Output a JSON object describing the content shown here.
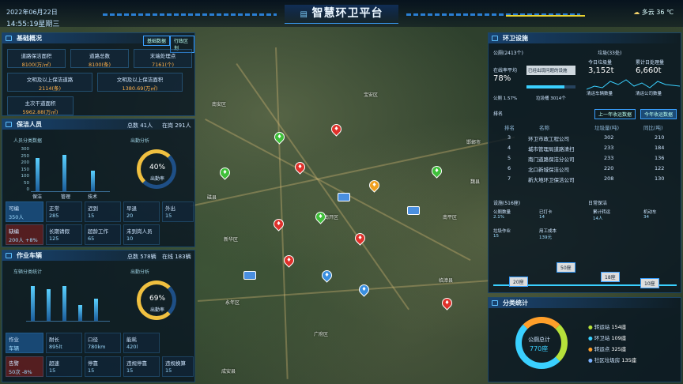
{
  "header": {
    "title": "智慧环卫平台",
    "date": "2022年06月22日",
    "time": "14:55:19星期三",
    "weather": "多云",
    "temp": "36 ℃"
  },
  "basic": {
    "title": "基础概况",
    "tab1": "基础数据",
    "tab2": "行政区划",
    "cells": [
      {
        "l": "道路保洁面积",
        "v": "8100(万/㎡)"
      },
      {
        "l": "道路总数",
        "v": "8100(条)"
      },
      {
        "l": "末端处理点",
        "v": "7161(个)"
      },
      {
        "l": "文明及以上保洁道路",
        "v": "2114(条)"
      },
      {
        "l": "文明及以上保洁面积",
        "v": "1380.69(万㎡)"
      },
      {
        "l": "主次干道面积",
        "v": "5962.88(万㎡)"
      }
    ]
  },
  "staff": {
    "title": "保洁人员",
    "total": "总数  41人",
    "online": "在岗 291人",
    "l1": "人员分类数据",
    "l2": "出勤分析",
    "yaxis": [
      "300",
      "250",
      "200",
      "150",
      "100",
      "50",
      "0"
    ],
    "cats": [
      "保洁",
      "管理",
      "技术"
    ],
    "rate": "40%",
    "rate_label": "出勤率",
    "grid": [
      {
        "l": "可编",
        "v": "350人"
      },
      {
        "l": "正常",
        "v": "285"
      },
      {
        "l": "迟到",
        "v": "15"
      },
      {
        "l": "早退",
        "v": "20"
      },
      {
        "l": "外出",
        "v": "15"
      },
      {
        "l": "缺编",
        "v": "200人 +8%"
      },
      {
        "l": "长期请假",
        "v": "125"
      },
      {
        "l": "超龄工作",
        "v": "65"
      },
      {
        "l": "未到岗人员",
        "v": "10"
      }
    ]
  },
  "vehicle": {
    "title": "作业车辆",
    "total": "总数  578辆",
    "online": "在线 183辆",
    "l1": "车辆分类统计",
    "l2": "出勤分析",
    "rate": "69%",
    "rate_label": "出勤率",
    "grid": [
      {
        "l": "作业",
        "v": "车辆"
      },
      {
        "l": "耐长",
        "v": "895lt"
      },
      {
        "l": "口径",
        "v": "780km"
      },
      {
        "l": "能耗",
        "v": "420l"
      },
      {
        "l": "告警",
        "v": "50次 -8%"
      },
      {
        "l": "超速",
        "v": "15"
      },
      {
        "l": "停靠",
        "v": "15"
      },
      {
        "l": "违规停靠",
        "v": "15"
      },
      {
        "l": "违规换算",
        "v": "15"
      }
    ]
  },
  "facility": {
    "title": "环卫设施",
    "toilet": "公厕(2413个)",
    "rate_label": "在线率平均",
    "rate": "78%",
    "btn": "已经出现问题的设施",
    "rate2": "公厕 1.57%",
    "rate3": "垃圾桶 3014个",
    "trash": "垃圾(33处)",
    "today": "今日垃圾量",
    "today_v": "3,152t",
    "total": "累计日处理量",
    "total_v": "6,660t",
    "t1": "清运车辆数量",
    "t2": "清运公司数量",
    "rank_title": "排名",
    "tab_a": "上一年收运数据",
    "tab_b": "今年收运数据",
    "rank": {
      "cols": [
        "排名",
        "名称",
        "垃圾量(吨)",
        "同比(吨)"
      ],
      "rows": [
        [
          "3",
          "环卫市政工程公司",
          "302",
          "210"
        ],
        [
          "4",
          "城市管理局道路清扫",
          "233",
          "184"
        ],
        [
          "5",
          "南门道路保洁分公司",
          "233",
          "136"
        ],
        [
          "6",
          "北口新城保洁公司",
          "220",
          "122"
        ],
        [
          "7",
          "新大地环卫保洁公司",
          "208",
          "130"
        ]
      ]
    },
    "stat1": "设施(516座)",
    "stat2": "日常保洁",
    "sub": [
      {
        "l": "公厕数量",
        "v": "2.1%"
      },
      {
        "l": "已打卡",
        "v": "14"
      },
      {
        "l": "累计转运",
        "v": "14人"
      },
      {
        "l": "机动车",
        "v": "34"
      },
      {
        "l": "垃圾作业",
        "v": "15"
      },
      {
        "l": "用工成本",
        "v": "139元"
      }
    ],
    "ticks": [
      "20座",
      "50座",
      "18座",
      "10座"
    ],
    "dist": "分类统计",
    "ring": "公厕总计",
    "ring_v": "770座",
    "legend": [
      {
        "l": "转运站",
        "v": "154座",
        "c": "#b6e13a"
      },
      {
        "l": "环卫站",
        "v": "109座",
        "c": "#3ad0ff"
      },
      {
        "l": "转运点",
        "v": "325座",
        "c": "#ff9f2a"
      },
      {
        "l": "社区垃圾房",
        "v": "135座",
        "c": "#7ab0ff"
      }
    ]
  },
  "map": {
    "labels": [
      "宝安区",
      "南安区",
      "南开区",
      "新华区",
      "永年区",
      "广府区",
      "南平区",
      "临漳县",
      "邯郸市",
      "成安县",
      "磁县",
      "魏县"
    ]
  }
}
